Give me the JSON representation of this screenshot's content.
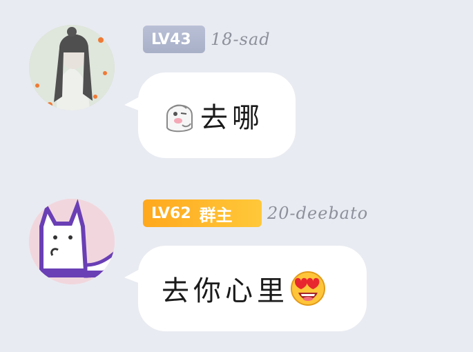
{
  "messages": [
    {
      "level_prefix": "LV",
      "level_number": "43",
      "role": "",
      "username": "18-sad",
      "sticker": "ghost-sticker-icon",
      "text": "去哪",
      "emoji": ""
    },
    {
      "level_prefix": "LV",
      "level_number": "62",
      "role": "群主",
      "username": "20-deebato",
      "sticker": "",
      "text": "去你心里",
      "emoji": "heart-eyes-emoji-icon"
    }
  ],
  "colors": {
    "background": "#e9ebf2",
    "badge_grey": "#b2b9cf",
    "badge_gold": "#ffb52a",
    "bubble": "#ffffff",
    "username": "#8d909a"
  }
}
